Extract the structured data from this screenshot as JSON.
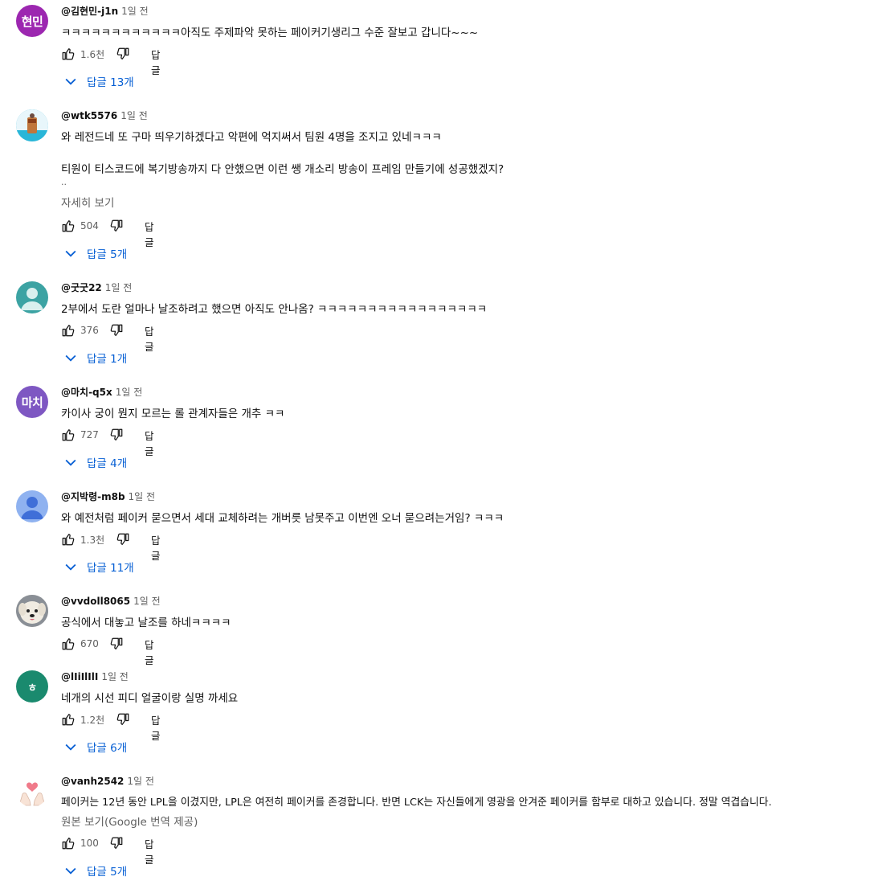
{
  "colors": {
    "link_blue": "#065fd4",
    "secondary_text": "#606060",
    "avatar_purple": "#9c27b0",
    "avatar_teal": "#3ca3a3",
    "avatar_violet": "#7e57c2",
    "avatar_blue": "#8fb2f0",
    "avatar_green": "#1a8a6e"
  },
  "icons": {
    "like": "thumbs-up-icon",
    "dislike": "thumbs-down-icon",
    "expand": "chevron-down-icon"
  },
  "reply_label": "답글",
  "comments": [
    {
      "author": "@김현민-j1n",
      "time": "1일 전",
      "avatar_text": "현민",
      "text": "ㅋㅋㅋㅋㅋㅋㅋㅋㅋㅋㅋㅋ아직도 주제파악 못하는 페이커기생리그 수준 잘보고 갑니다~~~",
      "likes": "1.6천",
      "replies": "답글 13개"
    },
    {
      "author": "@wtk5576",
      "time": "1일 전",
      "avatar_text": "",
      "text_lines": [
        "와 레전드네 또 구마 띄우기하겠다고 악편에 억지써서 팀원 4명을 조지고 있네ㅋㅋㅋ",
        "티원이 티스코드에 복기방송까지 다 안했으면 이런 쌩 개소리 방송이 프레임 만들기에 성공했겠지?"
      ],
      "ellipsis": "..",
      "read_more": "자세히 보기",
      "likes": "504",
      "replies": "답글 5개"
    },
    {
      "author": "@굿굿22",
      "time": "1일 전",
      "avatar_text": "",
      "text": "2부에서 도란 얼마나 날조하려고 했으면 아직도 안나옴? ㅋㅋㅋㅋㅋㅋㅋㅋㅋㅋㅋㅋㅋㅋㅋㅋㅋ",
      "likes": "376",
      "replies": "답글 1개"
    },
    {
      "author": "@마치-q5x",
      "time": "1일 전",
      "avatar_text": "마치",
      "text": "카이사 궁이 뭔지 모르는 롤 관계자들은 개추 ㅋㅋ",
      "likes": "727",
      "replies": "답글 4개"
    },
    {
      "author": "@지박령-m8b",
      "time": "1일 전",
      "avatar_text": "",
      "text": "와 예전처럼 페이커 묻으면서 세대 교체하려는 개버릇 남못주고 이번엔 오너 묻으려는거임? ㅋㅋㅋ",
      "likes": "1.3천",
      "replies": "답글 11개"
    },
    {
      "author": "@vvdoll8065",
      "time": "1일 전",
      "avatar_text": "",
      "text": "공식에서 대놓고 날조를 하네ㅋㅋㅋㅋ",
      "likes": "670",
      "replies": ""
    },
    {
      "author": "@lIiIlIlI",
      "time": "1일 전",
      "avatar_text": "ㅎ",
      "text": "네개의 시선 피디 얼굴이랑 실명 까세요",
      "likes": "1.2천",
      "replies": "답글 6개"
    },
    {
      "author": "@vanh2542",
      "time": "1일 전",
      "avatar_text": "",
      "text": "페이커는 12년 동안 LPL을 이겼지만, LPL은 여전히 페이커를 존경합니다. 반면 LCK는 자신들에게 영광을 안겨준 페이커를 함부로 대하고 있습니다. 정말 역겹습니다.",
      "translate_note": "원본 보기(Google 번역 제공)",
      "likes": "100",
      "replies": "답글 5개"
    }
  ]
}
